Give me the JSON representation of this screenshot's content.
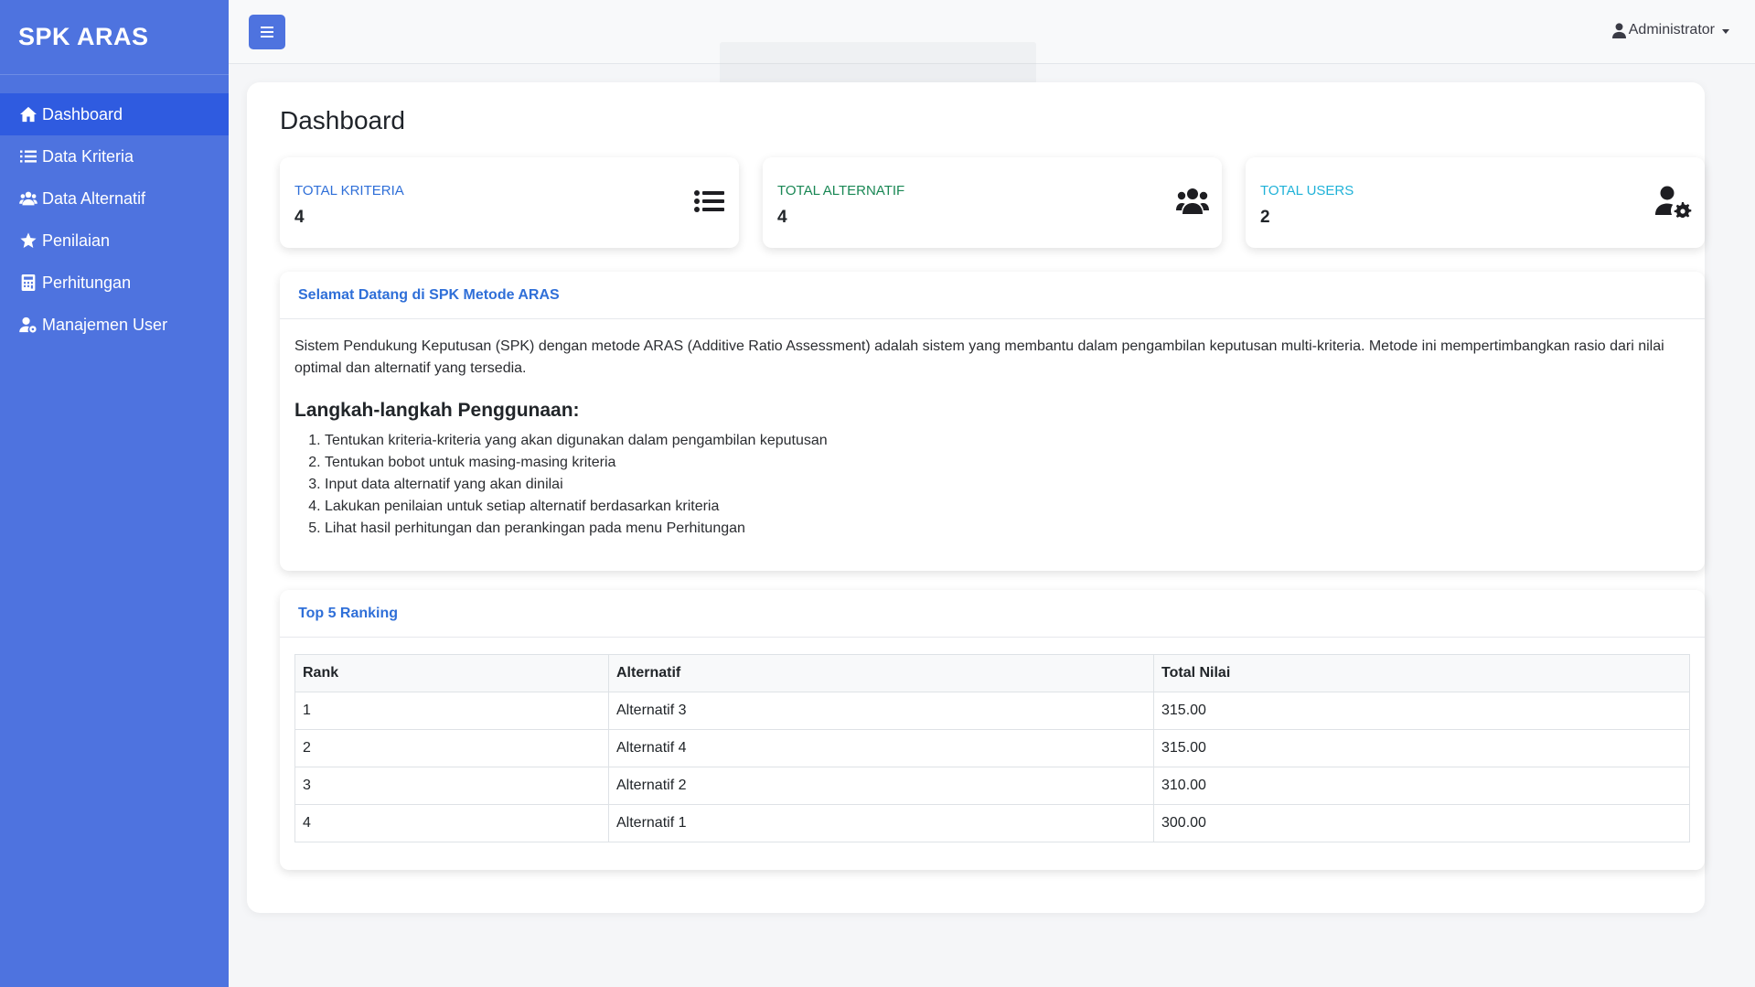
{
  "brand": "SPK ARAS",
  "sidebar": {
    "items": [
      {
        "label": "Dashboard",
        "icon": "home-icon",
        "active": true
      },
      {
        "label": "Data Kriteria",
        "icon": "list-icon"
      },
      {
        "label": "Data Alternatif",
        "icon": "users-icon"
      },
      {
        "label": "Penilaian",
        "icon": "star-icon"
      },
      {
        "label": "Perhitungan",
        "icon": "calculator-icon"
      },
      {
        "label": "Manajemen User",
        "icon": "user-gear-icon"
      }
    ]
  },
  "topbar": {
    "user_name": "Administrator"
  },
  "page": {
    "title": "Dashboard"
  },
  "stats": [
    {
      "label": "TOTAL KRITERIA",
      "value": "4",
      "color": "#2f6fd8",
      "icon": "list-icon"
    },
    {
      "label": "TOTAL ALTERNATIF",
      "value": "4",
      "color": "#198754",
      "icon": "users-icon"
    },
    {
      "label": "TOTAL USERS",
      "value": "2",
      "color": "#20b2d8",
      "icon": "user-gear-icon"
    }
  ],
  "welcome": {
    "title": "Selamat Datang di SPK Metode ARAS",
    "description": "Sistem Pendukung Keputusan (SPK) dengan metode ARAS (Additive Ratio Assessment) adalah sistem yang membantu dalam pengambilan keputusan multi-kriteria. Metode ini mempertimbangkan rasio dari nilai optimal dan alternatif yang tersedia.",
    "steps_title": "Langkah-langkah Penggunaan:",
    "steps": [
      "Tentukan kriteria-kriteria yang akan digunakan dalam pengambilan keputusan",
      "Tentukan bobot untuk masing-masing kriteria",
      "Input data alternatif yang akan dinilai",
      "Lakukan penilaian untuk setiap alternatif berdasarkan kriteria",
      "Lihat hasil perhitungan dan perankingan pada menu Perhitungan"
    ]
  },
  "ranking": {
    "title": "Top 5 Ranking",
    "columns": [
      "Rank",
      "Alternatif",
      "Total Nilai"
    ],
    "rows": [
      [
        "1",
        "Alternatif 3",
        "315.00"
      ],
      [
        "2",
        "Alternatif 4",
        "315.00"
      ],
      [
        "3",
        "Alternatif 2",
        "310.00"
      ],
      [
        "4",
        "Alternatif 1",
        "300.00"
      ]
    ]
  }
}
